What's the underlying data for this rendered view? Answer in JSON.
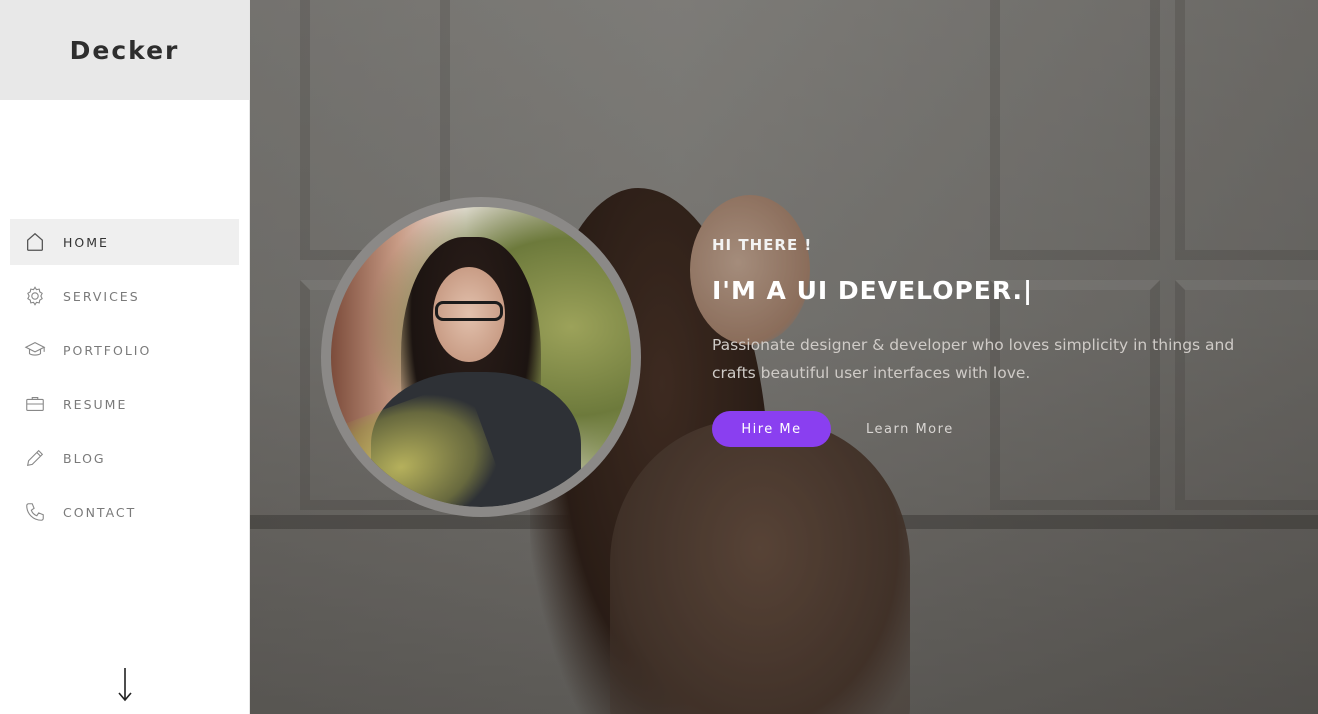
{
  "brand": {
    "name": "Decker"
  },
  "nav": {
    "items": [
      {
        "label": "HOME",
        "icon": "home-icon",
        "active": true
      },
      {
        "label": "SERVICES",
        "icon": "gear-icon",
        "active": false
      },
      {
        "label": "PORTFOLIO",
        "icon": "graduation-cap-icon",
        "active": false
      },
      {
        "label": "RESUME",
        "icon": "briefcase-icon",
        "active": false
      },
      {
        "label": "BLOG",
        "icon": "pencil-icon",
        "active": false
      },
      {
        "label": "CONTACT",
        "icon": "phone-icon",
        "active": false
      }
    ]
  },
  "hero": {
    "greeting": "HI THERE !",
    "headline": "I'M A UI DEVELOPER.|",
    "description": "Passionate designer & developer who loves simplicity in things and crafts beautiful user interfaces with love.",
    "hire_label": "Hire Me",
    "learn_label": "Learn More"
  },
  "colors": {
    "accent": "#8a3ff0",
    "sidebar_brand_bg": "#e8e8e8",
    "active_nav_bg": "#efefef"
  }
}
